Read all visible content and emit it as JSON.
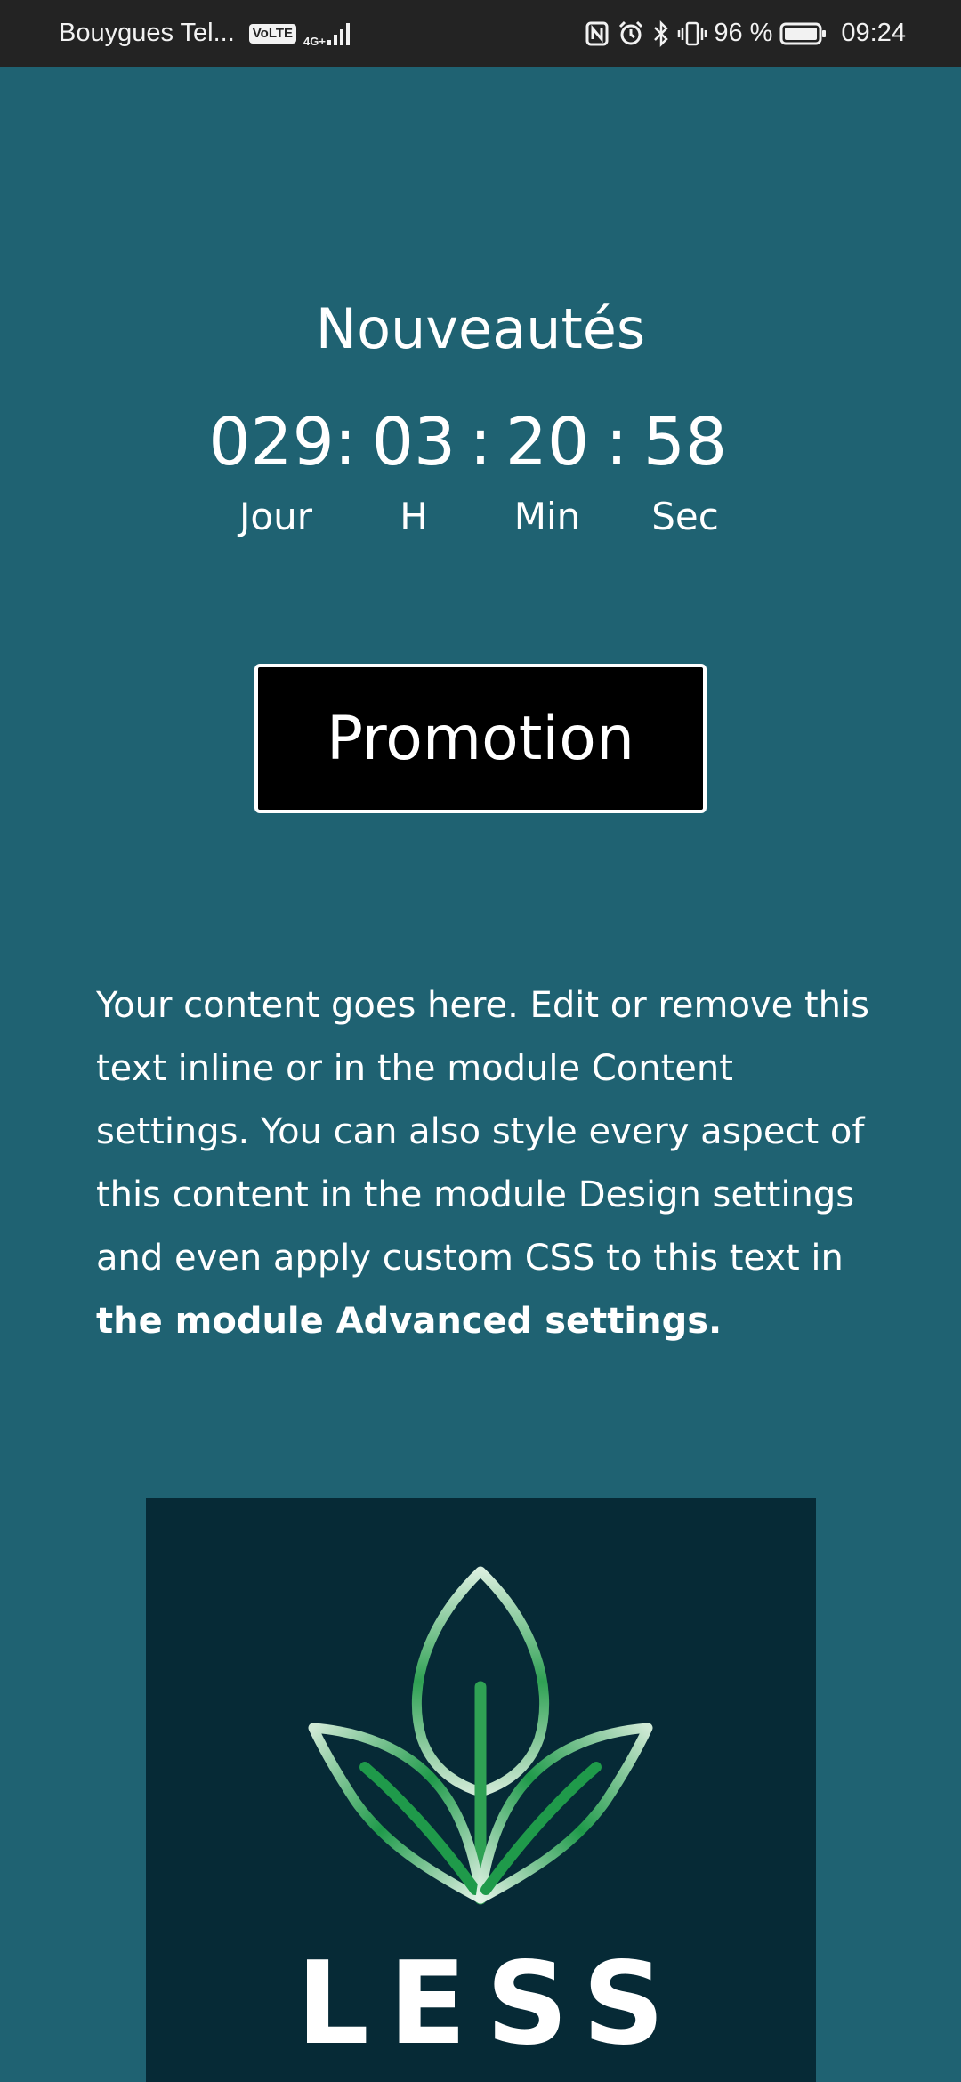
{
  "status_bar": {
    "carrier": "Bouygues Tel...",
    "volte": "VoLTE",
    "network": "4G+",
    "battery_percent": "96 %",
    "time": "09:24",
    "icons": [
      "signal-icon",
      "nfc-icon",
      "alarm-icon",
      "bluetooth-icon",
      "vibrate-icon",
      "battery-icon"
    ]
  },
  "section": {
    "title": "Nouveautés"
  },
  "countdown": {
    "days": "029:",
    "hours": "03",
    "separator_1": ":",
    "minutes": "20",
    "separator_2": ":",
    "seconds": "58",
    "labels": {
      "days": "Jour",
      "hours": "H",
      "minutes": "Min",
      "seconds": "Sec"
    }
  },
  "promo_button": {
    "label": "Promotion"
  },
  "content": {
    "text_plain": "Your content goes here. Edit or remove this text inline or in the module Content settings. You can also style every aspect of this content in the module Design settings and even apply custom CSS to this text in ",
    "text_bold": "the module Advanced settings."
  },
  "logo": {
    "word": "LESS",
    "icon": "leaf-sprout-icon"
  },
  "colors": {
    "background": "#1f6272",
    "status_bar": "#232323",
    "logo_background": "#062a36",
    "button_background": "#000000",
    "text": "#ffffff",
    "leaf_green": "#1f9a4a"
  }
}
